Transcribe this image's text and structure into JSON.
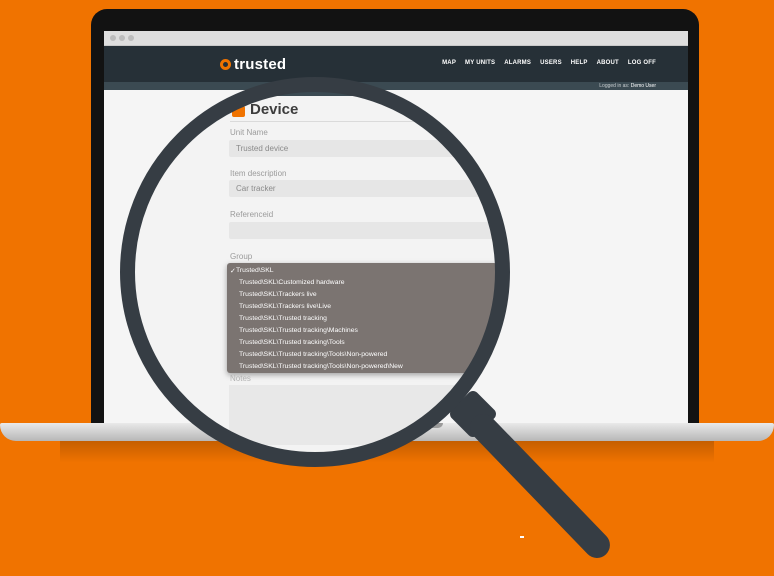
{
  "nav": {
    "logo_text": "trusted",
    "links": [
      "MAP",
      "MY UNITS",
      "ALARMS",
      "USERS",
      "HELP",
      "ABOUT",
      "LOG OFF"
    ],
    "logged_in_prefix": "Logged in as:",
    "logged_in_user": "Demo User"
  },
  "form": {
    "title": "Device",
    "unit_name_label": "Unit Name",
    "unit_name_value": "Trusted device",
    "item_description_label": "Item description",
    "item_description_value": "Car tracker",
    "reference_label": "Referenceid",
    "reference_value": "",
    "group_label": "Group",
    "notes_label": "Notes",
    "group_options": [
      "Trusted\\SKL",
      "Trusted\\SKL\\Customized hardware",
      "Trusted\\SKL\\Trackers live",
      "Trusted\\SKL\\Trackers live\\Live",
      "Trusted\\SKL\\Trusted tracking",
      "Trusted\\SKL\\Trusted tracking\\Machines",
      "Trusted\\SKL\\Trusted tracking\\Tools",
      "Trusted\\SKL\\Trusted tracking\\Tools\\Non-powered",
      "Trusted\\SKL\\Trusted tracking\\Tools\\Non-powered\\New"
    ],
    "selected_index": 0
  },
  "colors": {
    "background": "#f07300",
    "accent": "#f07300",
    "nav_bar": "#263037",
    "dropdown": "#7b7471",
    "magnifier": "#363d44"
  },
  "icons": {
    "check": "✓"
  }
}
